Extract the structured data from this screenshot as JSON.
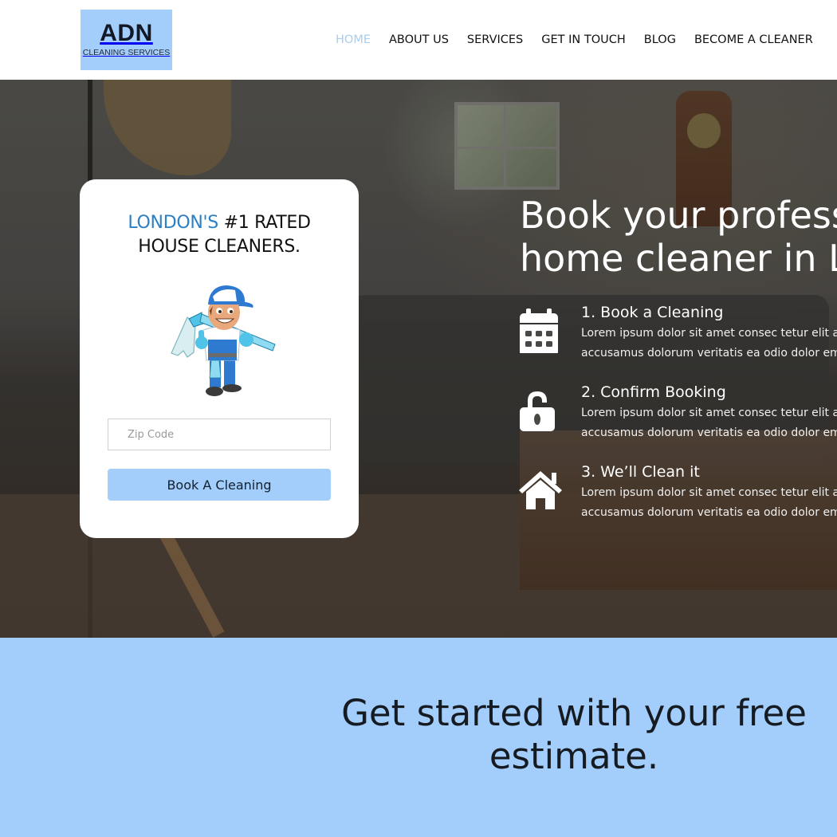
{
  "header": {
    "logo": {
      "main": "ADN",
      "sub": "CLEANING SERVICES"
    },
    "nav": [
      {
        "label": "HOME",
        "active": true
      },
      {
        "label": "ABOUT US",
        "active": false
      },
      {
        "label": "SERVICES",
        "active": false
      },
      {
        "label": "GET IN TOUCH",
        "active": false
      },
      {
        "label": "BLOG",
        "active": false
      },
      {
        "label": "BECOME A CLEANER",
        "active": false
      }
    ]
  },
  "card": {
    "title_accent": "LONDON'S",
    "title_rest": " #1 RATED",
    "title_line2": "HOUSE CLEANERS.",
    "mascot_icon": "cleaner-mascot-icon",
    "zip": {
      "value": "",
      "placeholder": "Zip Code"
    },
    "button_label": "Book A Cleaning"
  },
  "hero": {
    "heading_line1": "Book your professional",
    "heading_line2": "home cleaner in London",
    "steps": [
      {
        "icon": "calendar-icon",
        "title": "1. Book a Cleaning",
        "desc_line1": "Lorem ipsum dolor sit amet consec tetur elit a",
        "desc_line2": "accusamus dolorum veritatis ea odio dolor em"
      },
      {
        "icon": "unlock-icon",
        "title": "2. Confirm Booking",
        "desc_line1": "Lorem ipsum dolor sit amet consec tetur elit a",
        "desc_line2": "accusamus dolorum veritatis ea odio dolor em"
      },
      {
        "icon": "home-icon",
        "title": "3. We’ll Clean it",
        "desc_line1": "Lorem ipsum dolor sit amet consec tetur elit a",
        "desc_line2": "accusamus dolorum veritatis ea odio dolor em"
      }
    ]
  },
  "estimate": {
    "heading_line1": "Get started with your free",
    "heading_line2": "estimate."
  },
  "colors": {
    "brand_light_blue": "#a3cdfa",
    "accent_blue": "#2b7fc5",
    "nav_active": "#a7cdf0",
    "dark_text": "#161b22"
  }
}
